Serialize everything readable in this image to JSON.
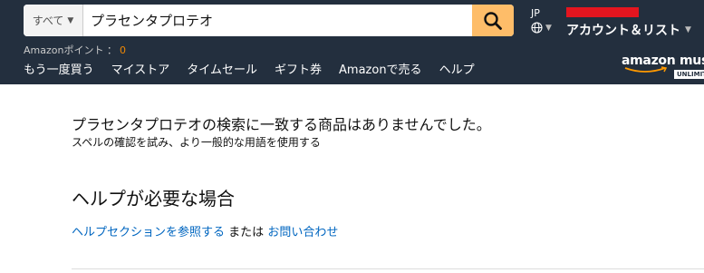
{
  "header": {
    "search": {
      "department": "すべて",
      "query": "プラセンタプロテオ"
    },
    "locale": {
      "code": "JP"
    },
    "account": {
      "label": "アカウント＆リスト"
    },
    "points": {
      "label": "Amazonポイント ：",
      "value": "0"
    },
    "nav": [
      "もう一度買う",
      "マイストア",
      "タイムセール",
      "ギフト券",
      "Amazonで売る",
      "ヘルプ"
    ],
    "logo": {
      "text": "amazon mus",
      "badge": "UNLIMIT"
    }
  },
  "main": {
    "no_results": "プラセンタプロテオの検索に一致する商品はありませんでした。",
    "tip": "スペルの確認を試み、より一般的な用語を使用する",
    "help_heading": "ヘルプが必要な場合",
    "help_link": "ヘルプセクションを参照する",
    "help_or": "または",
    "contact_link": "お問い合わせ"
  },
  "colors": {
    "header_bg": "#232f3e",
    "search_button": "#febd69",
    "link": "#0066c0",
    "points_value": "#f08804"
  }
}
